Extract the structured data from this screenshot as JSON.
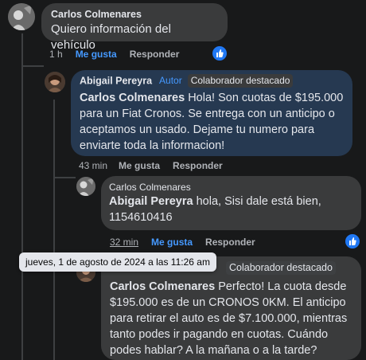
{
  "comments": [
    {
      "author": "Carlos Colmenares",
      "text": "Quiero información del vehículo",
      "time": "1 h",
      "like_label": "Me gusta",
      "reply_label": "Responder"
    },
    {
      "author": "Abigail Pereyra",
      "badges": [
        "Autor",
        "Colaborador destacado"
      ],
      "mention": "Carlos Colmenares",
      "text": " Hola! Son cuotas de $195.000 para un Fiat Cronos. Se entrega con un anticipo o aceptamos un usado. Dejame tu numero para enviarte toda la informacion!",
      "time": "43 min",
      "like_label": "Me gusta",
      "reply_label": "Responder"
    },
    {
      "author": "Carlos Colmenares",
      "mention": "Abigail Pereyra",
      "text": " hola, Sisi dale está bien, 1154610416",
      "time": "32 min",
      "like_label": "Me gusta",
      "reply_label": "Responder"
    },
    {
      "badges": [
        "Colaborador destacado"
      ],
      "mention": "Carlos Colmenares",
      "text": " Perfecto! La cuota desde $195.000 es de un CRONOS 0KM. El anticipo para retirar el auto es de $7.100.000, mientras tanto podes ir pagando en cuotas. Cuándo podes hablar? A la mañana o a la tarde?"
    }
  ],
  "tooltip": "jueves, 1 de agosto de 2024 a las 11:26 am",
  "colors": {
    "background": "#18191a",
    "bubble": "#3a3b3c",
    "author_bubble": "#263951",
    "accent": "#4599ff",
    "like_badge": "#2078f4"
  }
}
